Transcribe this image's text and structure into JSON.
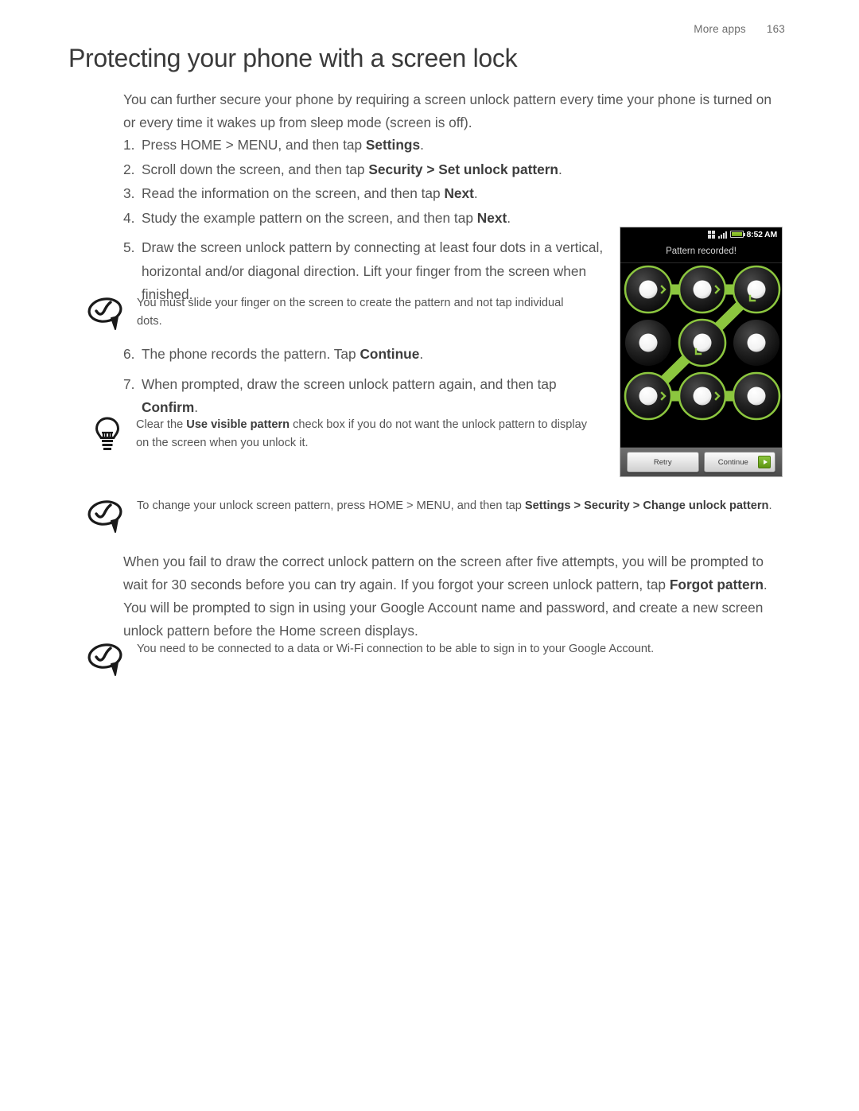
{
  "header": {
    "section": "More apps",
    "page": "163"
  },
  "title": "Protecting your phone with a screen lock",
  "intro": "You can further secure your phone by requiring a screen unlock pattern every time your phone is turned on or every time it wakes up from sleep mode (screen is off).",
  "steps": [
    {
      "num": "1.",
      "html": "Press HOME > MENU, and then tap <b>Settings</b>."
    },
    {
      "num": "2.",
      "html": "Scroll down the screen, and then tap <b>Security &gt; Set unlock pattern</b>."
    },
    {
      "num": "3.",
      "html": "Read the information on the screen, and then tap <b>Next</b>."
    },
    {
      "num": "4.",
      "html": "Study the example pattern on the screen, and then tap <b>Next</b>."
    },
    {
      "num": "5.",
      "html": "Draw the screen unlock pattern by connecting at least four dots in a vertical, horizontal and/or diagonal direction. Lift your finger from the screen when finished."
    },
    {
      "num": "6.",
      "html": "The phone records the pattern. Tap <b>Continue</b>."
    },
    {
      "num": "7.",
      "html": "When prompted, draw the screen unlock pattern again, and then tap <b>Confirm</b>."
    }
  ],
  "callouts": {
    "note_slide": {
      "icon": "note-icon",
      "html": "You must slide your finger on the screen to create the pattern and not tap individual dots."
    },
    "tip_visible": {
      "icon": "lightbulb-icon",
      "html": "Clear the <b>Use visible pattern</b> check box if you do not want the unlock pattern to display on the screen when you unlock it."
    },
    "note_change": {
      "icon": "note-icon",
      "html": "To change your unlock screen pattern, press HOME > MENU, and then tap <b>Settings &gt; Security &gt; Change unlock pattern</b>."
    },
    "note_wifi": {
      "icon": "note-icon",
      "html": "You need to be connected to a data or Wi-Fi connection to be able to sign in to your Google Account."
    }
  },
  "paragraph": "When you fail to draw the correct unlock pattern on the screen after five attempts, you will be prompted to wait for 30 seconds before you can try again. If you forgot your screen unlock pattern, tap <b>Forgot pattern</b>. You will be prompted to sign in using your Google Account name and password, and create a new screen unlock pattern before the Home screen displays.",
  "phone": {
    "statusbar": {
      "clock": "8:52 AM",
      "icons": [
        "data-transfer-icon",
        "signal-bars-icon",
        "battery-icon"
      ]
    },
    "message": "Pattern recorded!",
    "pattern": {
      "accent_color": "#8cc63f",
      "dot_dark": "#1c1c1c",
      "sequence": [
        0,
        1,
        2,
        4,
        6,
        7,
        8
      ],
      "grid_rows": 3,
      "grid_cols": 3
    },
    "buttons": [
      {
        "label": "Retry",
        "icon": null
      },
      {
        "label": "Continue",
        "icon": "green-arrow-icon"
      }
    ]
  }
}
